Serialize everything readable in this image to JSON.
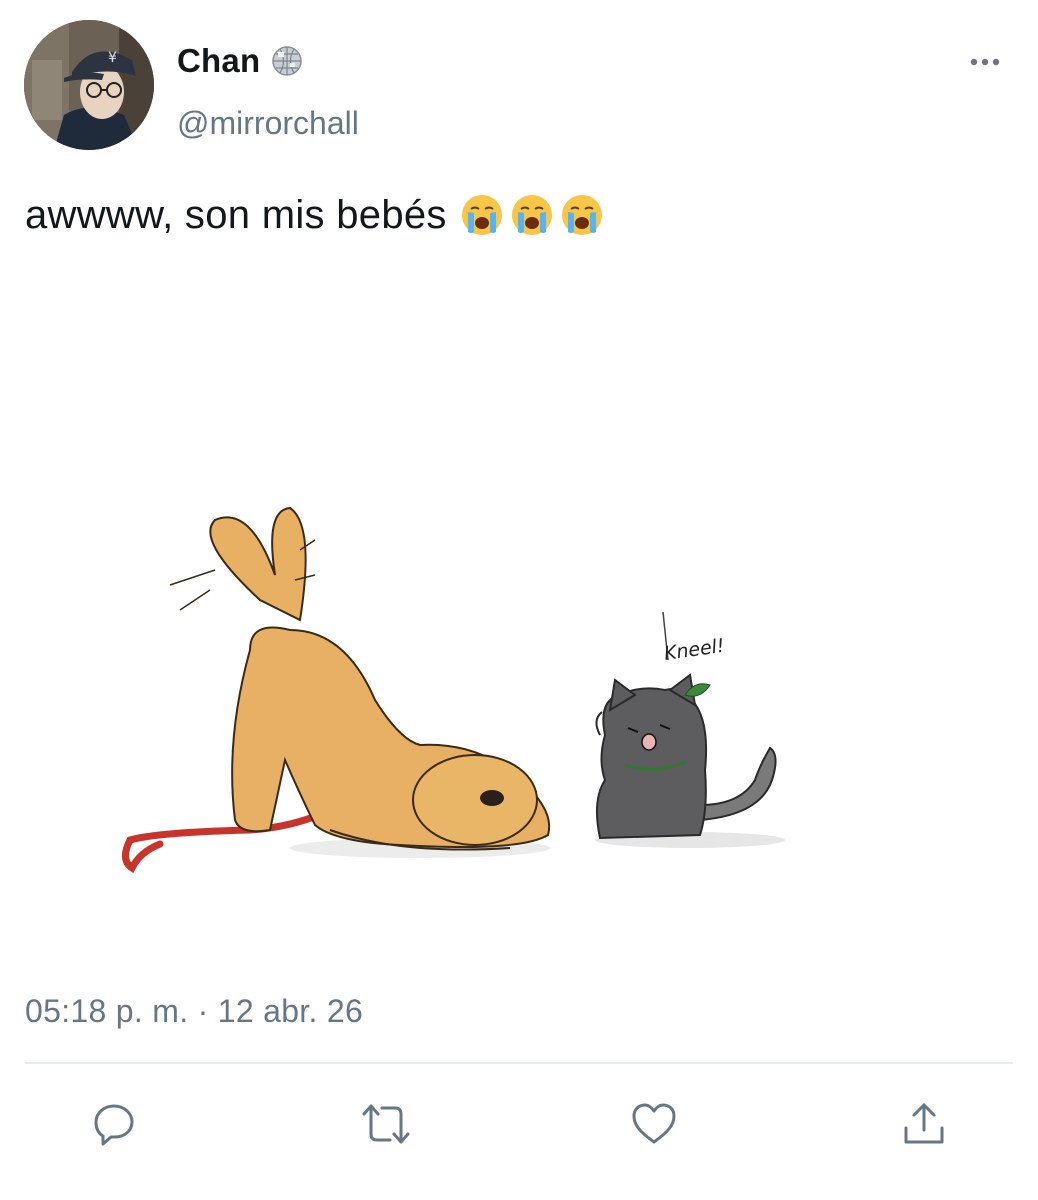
{
  "author": {
    "display_name": "Chan",
    "handle": "@mirrorchall",
    "badge_icon": "disco-ball-icon"
  },
  "tweet": {
    "text": "awwww, son mis bebés",
    "emojis": [
      "loudly-crying-face-emoji",
      "loudly-crying-face-emoji",
      "loudly-crying-face-emoji"
    ],
    "media_caption": "Kneel!",
    "timestamp": "05:18 p. m. · 12 abr. 26"
  },
  "actions": {
    "reply_icon": "reply-icon",
    "retweet_icon": "retweet-icon",
    "like_icon": "heart-icon",
    "share_icon": "share-icon"
  },
  "colors": {
    "text": "#14171a",
    "secondary": "#657786",
    "icon": "#657786",
    "divider": "#e6ecf0"
  }
}
